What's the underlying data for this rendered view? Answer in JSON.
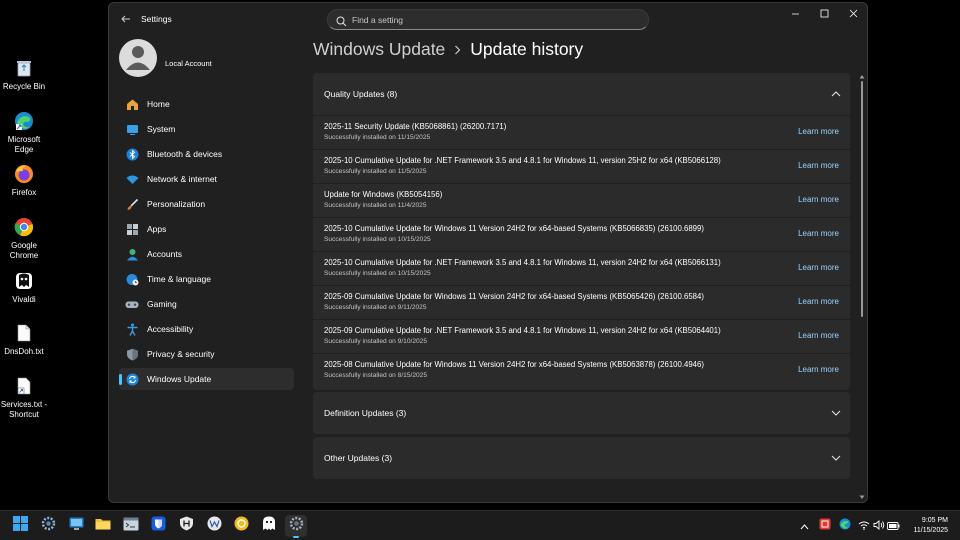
{
  "desktop": {
    "icons": [
      {
        "label": "Recycle Bin",
        "icon": "recycle-bin-icon"
      },
      {
        "label": "Microsoft Edge",
        "icon": "edge-icon"
      },
      {
        "label": "Firefox",
        "icon": "firefox-icon"
      },
      {
        "label": "Google Chrome",
        "icon": "chrome-icon"
      },
      {
        "label": "Vivaldi",
        "icon": "vivaldi-icon"
      },
      {
        "label": "DnsDoh.txt",
        "icon": "text-file-icon"
      },
      {
        "label": "Services.txt - Shortcut",
        "icon": "shortcut-file-icon"
      }
    ]
  },
  "window": {
    "app_title": "Settings",
    "search": {
      "placeholder": "Find a setting",
      "value": ""
    }
  },
  "account": {
    "name": "Local Account"
  },
  "sidebar": {
    "items": [
      {
        "label": "Home",
        "icon": "home-icon"
      },
      {
        "label": "System",
        "icon": "system-icon"
      },
      {
        "label": "Bluetooth & devices",
        "icon": "bluetooth-icon"
      },
      {
        "label": "Network & internet",
        "icon": "wifi-icon"
      },
      {
        "label": "Personalization",
        "icon": "brush-icon"
      },
      {
        "label": "Apps",
        "icon": "apps-icon"
      },
      {
        "label": "Accounts",
        "icon": "accounts-icon"
      },
      {
        "label": "Time & language",
        "icon": "globe-clock-icon"
      },
      {
        "label": "Gaming",
        "icon": "gamepad-icon"
      },
      {
        "label": "Accessibility",
        "icon": "accessibility-icon"
      },
      {
        "label": "Privacy & security",
        "icon": "shield-icon"
      },
      {
        "label": "Windows Update",
        "icon": "sync-icon",
        "active": true
      }
    ]
  },
  "breadcrumb": {
    "parent": "Windows Update",
    "current": "Update history"
  },
  "sections": {
    "quality": {
      "title": "Quality Updates (8)",
      "expanded": true,
      "link_label": "Learn more",
      "updates": [
        {
          "name": "2025-11 Security Update (KB5068861) (26200.7171)",
          "status": "Successfully installed on 11/15/2025"
        },
        {
          "name": "2025-10 Cumulative Update for .NET Framework 3.5 and 4.8.1 for Windows 11, version 25H2 for x64 (KB5066128)",
          "status": "Successfully installed on 11/5/2025"
        },
        {
          "name": "Update for Windows (KB5054156)",
          "status": "Successfully installed on 11/4/2025"
        },
        {
          "name": "2025-10 Cumulative Update for Windows 11 Version 24H2 for x64-based Systems (KB5066835) (26100.6899)",
          "status": "Successfully installed on 10/15/2025"
        },
        {
          "name": "2025-10 Cumulative Update for .NET Framework 3.5 and 4.8.1 for Windows 11, version 24H2 for x64 (KB5066131)",
          "status": "Successfully installed on 10/15/2025"
        },
        {
          "name": "2025-09 Cumulative Update for Windows 11 Version 24H2 for x64-based Systems (KB5065426) (26100.6584)",
          "status": "Successfully installed on 9/11/2025"
        },
        {
          "name": "2025-09 Cumulative Update for .NET Framework 3.5 and 4.8.1 for Windows 11, version 24H2 for x64 (KB5064401)",
          "status": "Successfully installed on 9/10/2025"
        },
        {
          "name": "2025-08 Cumulative Update for Windows 11 Version 24H2 for x64-based Systems (KB5063878) (26100.4946)",
          "status": "Successfully installed on 8/15/2025"
        }
      ]
    },
    "definition": {
      "title": "Definition Updates (3)",
      "expanded": false
    },
    "other": {
      "title": "Other Updates (3)",
      "expanded": false
    }
  },
  "taskbar": {
    "apps": [
      "start-icon",
      "settings-gear-icon",
      "monitor-app-icon",
      "file-explorer-icon",
      "terminal-app-icon",
      "bitwarden-icon",
      "hyper-v-icon",
      "wordpad-icon",
      "yellow-app-icon",
      "ghost-app-icon",
      "settings-app-icon"
    ],
    "tray": [
      "chevron-up-icon",
      "red-app-icon",
      "edge-tray-icon",
      "wifi-tray-icon",
      "volume-icon",
      "battery-icon"
    ],
    "time": "9:05 PM",
    "date": "11/15/2025"
  },
  "colors": {
    "accent": "#4cc2ff",
    "link": "#99d3ff",
    "window_bg": "#202020",
    "card_bg": "#2b2b2b"
  }
}
